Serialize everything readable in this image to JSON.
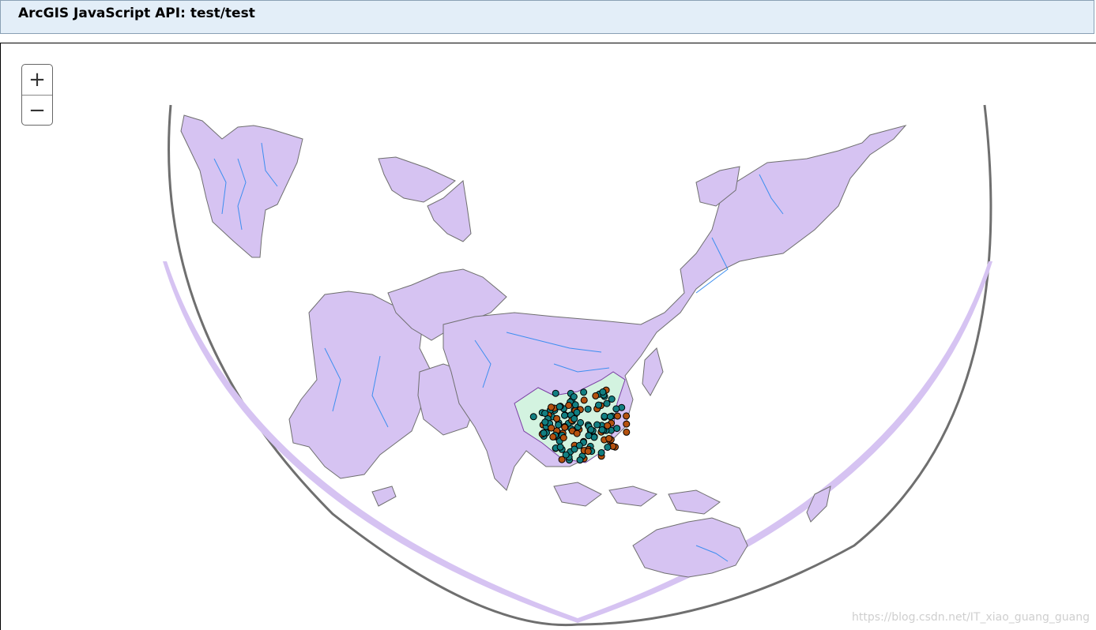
{
  "header": {
    "title": "ArcGIS JavaScript API: test/test"
  },
  "zoom": {
    "in_label": "+",
    "out_label": "−"
  },
  "watermark": "https://blog.csdn.net/IT_xiao_guang_guang",
  "colors": {
    "header_bg": "#e3eef8",
    "land_fill": "#d6c3f2",
    "land_stroke": "#6f6f6f",
    "river": "#3d8ef0",
    "highlight_region": "#d3f3e0",
    "point_teal": "#127f82",
    "point_orange": "#b4510f",
    "globe_outline": "#6f6f6f"
  },
  "map": {
    "projection": "world map projected around east asia",
    "layers": [
      "country boundaries",
      "rivers",
      "highlighted region",
      "point features"
    ],
    "point_categories": [
      "teal",
      "orange"
    ]
  }
}
